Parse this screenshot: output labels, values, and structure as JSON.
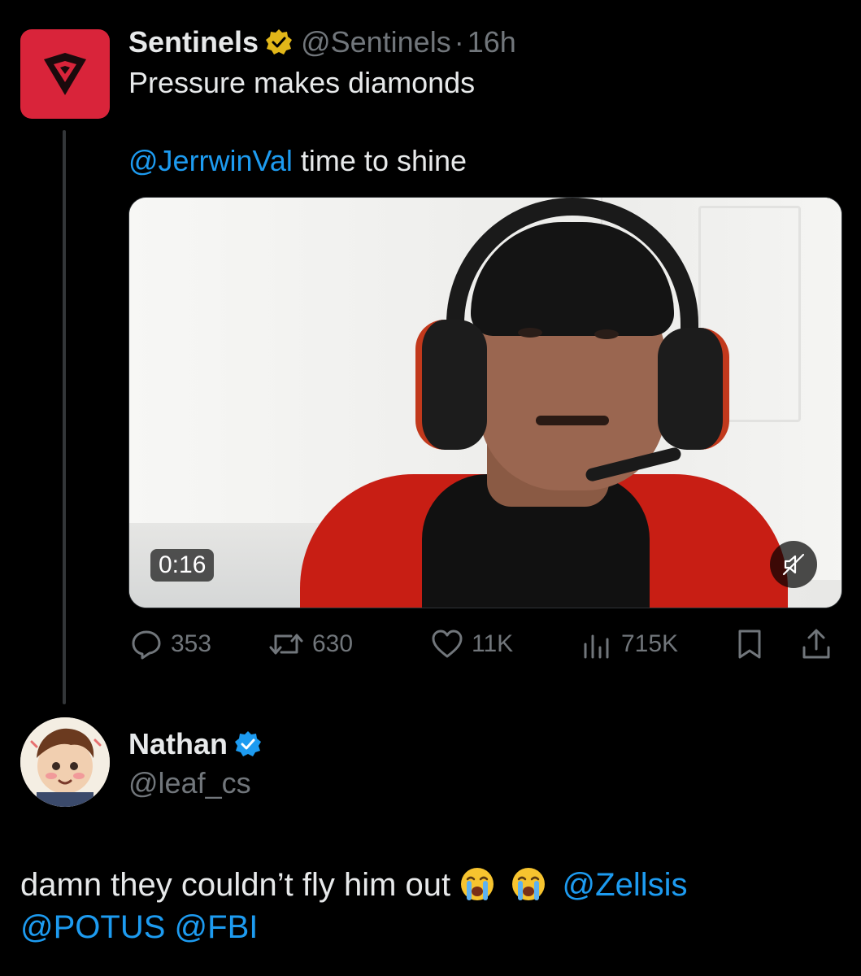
{
  "parent": {
    "name": "Sentinels",
    "handle": "@Sentinels",
    "separator": "·",
    "time": "16h",
    "text_line1": "Pressure makes diamonds",
    "mention": "@JerrwinVal",
    "text_line2": " time to shine",
    "video_duration": "0:16",
    "stats": {
      "replies": "353",
      "reposts": "630",
      "likes": "11K",
      "views": "715K"
    }
  },
  "reply": {
    "name": "Nathan",
    "handle": "@leaf_cs",
    "text": "damn they couldn’t fly him out",
    "mention1": "@Zellsis",
    "mention2": "@POTUS",
    "mention3": "@FBI"
  },
  "colors": {
    "background": "#000000",
    "text": "#e7e9ea",
    "muted": "#71767b",
    "link": "#1d9bf0",
    "sentinels_red": "#d9243a",
    "gold_badge": "#e2b719",
    "blue_badge": "#1d9bf0"
  },
  "icons": [
    "reply-icon",
    "repost-icon",
    "like-icon",
    "views-icon",
    "bookmark-icon",
    "share-icon",
    "mute-icon",
    "verified-gold-icon",
    "verified-blue-icon",
    "loudly-crying-face-emoji"
  ]
}
